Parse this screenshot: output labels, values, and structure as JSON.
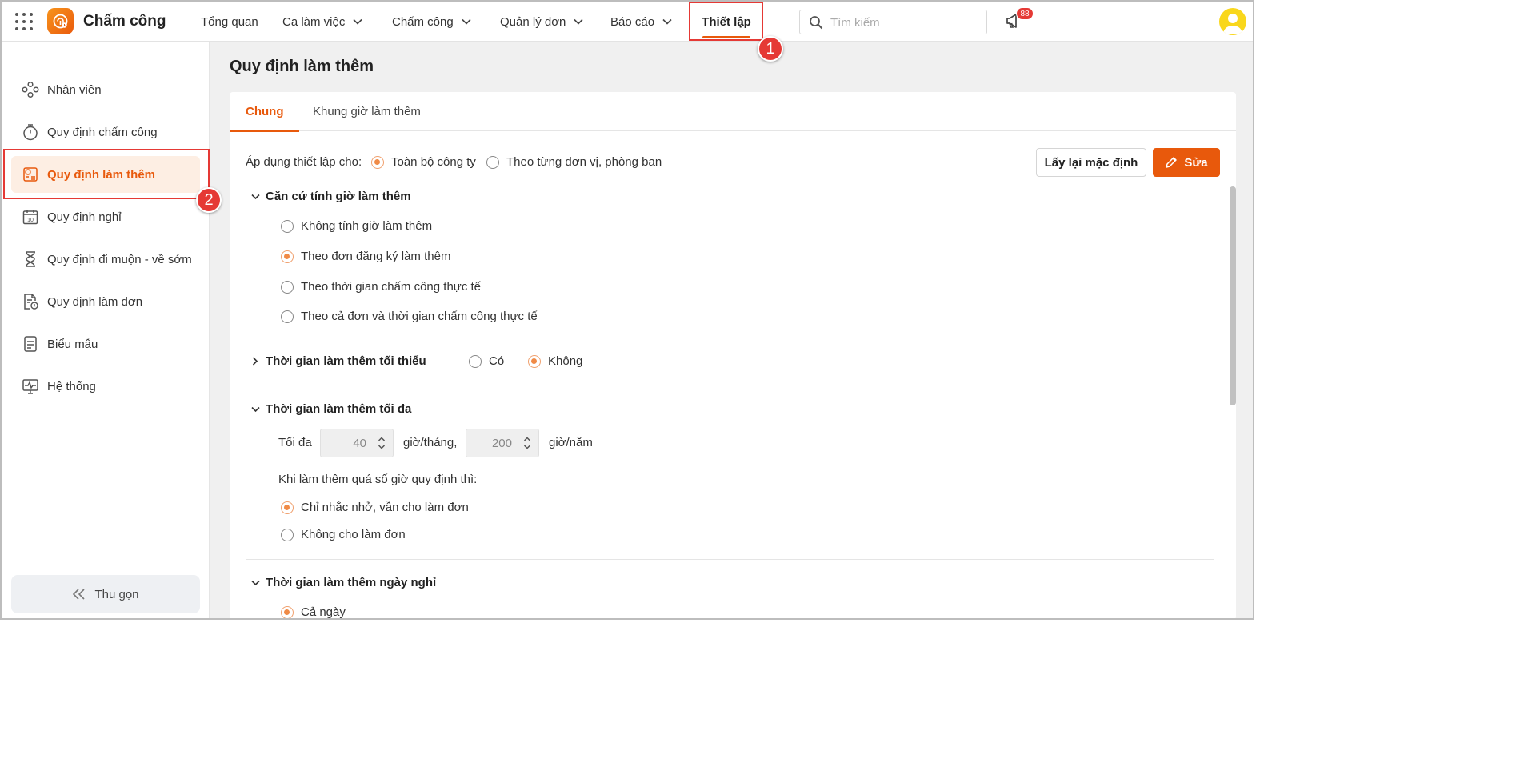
{
  "header": {
    "app_title": "Chấm công",
    "nav": [
      {
        "label": "Tổng quan"
      },
      {
        "label": "Ca làm việc"
      },
      {
        "label": "Chấm công"
      },
      {
        "label": "Quản lý đơn"
      },
      {
        "label": "Báo cáo"
      },
      {
        "label": "Thiết lập"
      }
    ],
    "search_placeholder": "Tìm kiếm",
    "notification_count": "88"
  },
  "annotations": {
    "one": "1",
    "two": "2"
  },
  "sidebar": {
    "items": [
      {
        "label": "Nhân viên",
        "icon": "people-network-icon"
      },
      {
        "label": "Quy định chấm công",
        "icon": "stopwatch-icon"
      },
      {
        "label": "Quy định làm thêm",
        "icon": "overtime-icon"
      },
      {
        "label": "Quy định nghỉ",
        "icon": "calendar-icon"
      },
      {
        "label": "Quy định đi muộn - về sớm",
        "icon": "hourglass-icon"
      },
      {
        "label": "Quy định làm đơn",
        "icon": "document-clock-icon"
      },
      {
        "label": "Biểu mẫu",
        "icon": "document-icon"
      },
      {
        "label": "Hệ thống",
        "icon": "monitor-icon"
      }
    ],
    "collapse_label": "Thu gọn"
  },
  "main": {
    "page_title": "Quy định làm thêm",
    "tabs": [
      {
        "label": "Chung"
      },
      {
        "label": "Khung giờ làm thêm"
      }
    ],
    "apply_label": "Áp dụng thiết lập cho:",
    "apply_options": [
      {
        "label": "Toàn bộ công ty",
        "selected": true
      },
      {
        "label": "Theo từng đơn vị, phòng ban",
        "selected": false
      }
    ],
    "reset_button": "Lấy lại mặc định",
    "edit_button": "Sửa",
    "basis_section": {
      "title": "Căn cứ tính giờ làm thêm",
      "options": [
        {
          "label": "Không tính giờ làm thêm",
          "selected": false
        },
        {
          "label": "Theo đơn đăng ký làm thêm",
          "selected": true
        },
        {
          "label": "Theo thời gian chấm công thực tế",
          "selected": false
        },
        {
          "label": "Theo cả đơn và thời gian chấm công thực tế",
          "selected": false
        }
      ]
    },
    "min_section": {
      "title": "Thời gian làm thêm tối thiểu",
      "options": [
        {
          "label": "Có",
          "selected": false
        },
        {
          "label": "Không",
          "selected": true
        }
      ]
    },
    "max_section": {
      "title": "Thời gian làm thêm tối đa",
      "max_label": "Tối đa",
      "per_month_value": "40",
      "per_month_unit": "giờ/tháng,",
      "per_year_value": "200",
      "per_year_unit": "giờ/năm",
      "exceed_label": "Khi làm thêm quá số giờ quy định thì:",
      "exceed_options": [
        {
          "label": "Chỉ nhắc nhở, vẫn cho làm đơn",
          "selected": true
        },
        {
          "label": "Không cho làm đơn",
          "selected": false
        }
      ]
    },
    "holiday_section": {
      "title": "Thời gian làm thêm ngày nghỉ",
      "first_option": "Cả ngày"
    }
  },
  "colors": {
    "accent": "#e8590c",
    "annotation": "#e53935",
    "active_bg": "#fdeee3"
  }
}
